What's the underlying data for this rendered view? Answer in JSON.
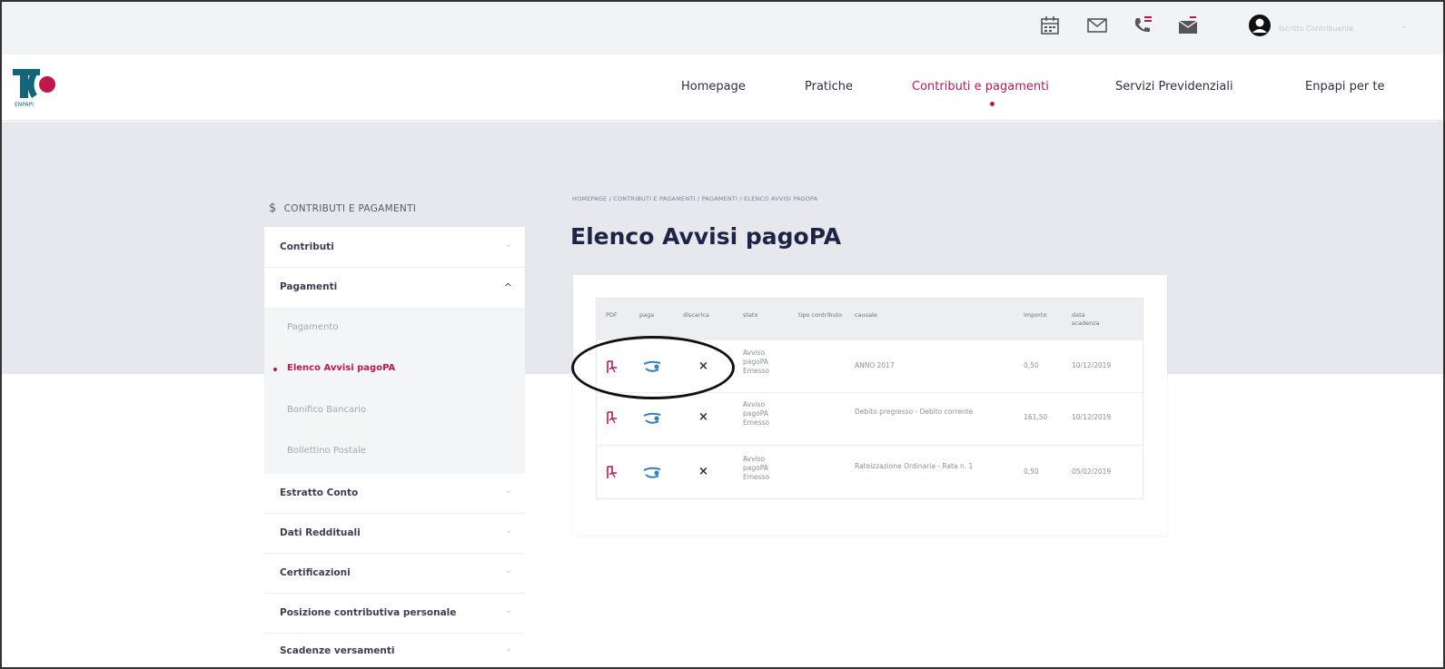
{
  "header": {
    "user_name": "Iscritto Contribuente",
    "utility_icons": [
      "calendar-icon",
      "mail-icon",
      "phone-notification-icon",
      "message-inbox-icon",
      "user-avatar-icon"
    ]
  },
  "brand": {
    "logo_text": "ENPAPI",
    "accent_color": "#c0184a",
    "logo_color": "#14657a"
  },
  "nav": {
    "items": [
      {
        "label": "Homepage"
      },
      {
        "label": "Pratiche"
      },
      {
        "label": "Contributi e pagamenti",
        "active": true
      },
      {
        "label": "Servizi Previdenziali"
      },
      {
        "label": "Enpapi per te"
      }
    ]
  },
  "sidebar": {
    "heading": "CONTRIBUTI E PAGAMENTI",
    "heading_icon": "$",
    "items": [
      {
        "label": "Contributi",
        "expanded": false
      },
      {
        "label": "Pagamenti",
        "expanded": true
      },
      {
        "label": "Estratto Conto",
        "expanded": false
      },
      {
        "label": "Dati Reddituali",
        "expanded": false
      },
      {
        "label": "Certificazioni",
        "expanded": false
      },
      {
        "label": "Posizione contributiva personale",
        "expanded": false
      },
      {
        "label": "Scadenze versamenti",
        "expanded": false
      }
    ],
    "sub_items": [
      {
        "label": "Pagamento",
        "active": false
      },
      {
        "label": "Elenco Avvisi pagoPA",
        "active": true
      },
      {
        "label": "Bonifico Bancario",
        "active": false
      },
      {
        "label": "Bollettino Postale",
        "active": false
      }
    ]
  },
  "main": {
    "breadcrumb": "HOMEPAGE / CONTRIBUTI E PAGAMENTI / PAGAMENTI / ELENCO AVVISI PAGOPA",
    "title": "Elenco Avvisi pagoPA",
    "table": {
      "headers": [
        "PDF",
        "paga",
        "discarica",
        "stato",
        "tipo contributo",
        "causale",
        "importo",
        "data scadenza"
      ],
      "rows": [
        {
          "stato": "Avviso pagoPA Emesso",
          "tipo": "",
          "causale": "ANNO 2017",
          "importo": "0,50",
          "scadenza": "10/12/2019"
        },
        {
          "stato": "Avviso pagoPA Emesso",
          "tipo": "",
          "causale": "Debito pregresso - Debito corrente",
          "importo": "161,50",
          "scadenza": "10/12/2019"
        },
        {
          "stato": "Avviso pagoPA Emesso",
          "tipo": "",
          "causale": "Rateizzazione Ordinaria - Rata n. 1",
          "importo": "0,50",
          "scadenza": "05/02/2019"
        }
      ],
      "x_mark": "×"
    }
  }
}
